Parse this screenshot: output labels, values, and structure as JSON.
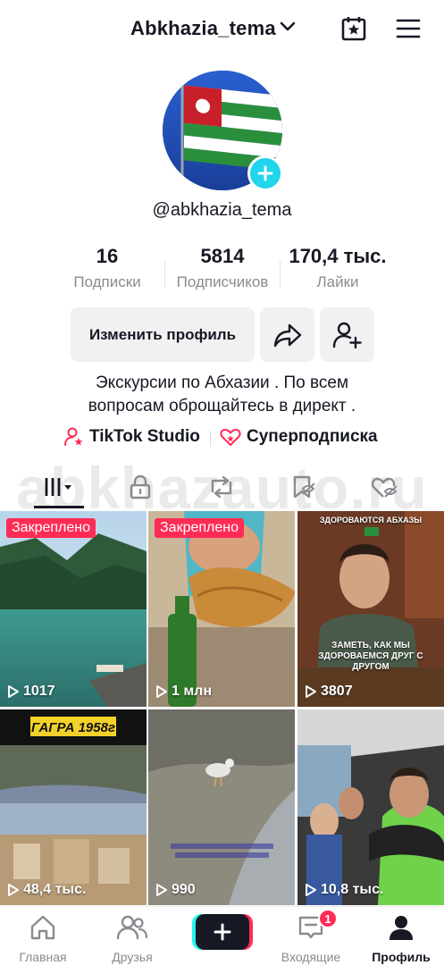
{
  "header": {
    "username": "Abkhazia_tema"
  },
  "profile": {
    "handle": "@abkhazia_tema",
    "stats": [
      {
        "value": "16",
        "label": "Подписки"
      },
      {
        "value": "5814",
        "label": "Подписчиков"
      },
      {
        "value": "170,4 тыс.",
        "label": "Лайки"
      }
    ],
    "edit_button": "Изменить профиль",
    "bio_lines": [
      "Экскурсии по Абхазии .  По всем",
      "вопросам оброщайтесь в директ ."
    ],
    "links": {
      "studio": "TikTok Studio",
      "subscription": "Суперподписка"
    }
  },
  "watermark": "abkhazauto.ru",
  "videos": [
    {
      "views": "1017",
      "pinned": "Закреплено"
    },
    {
      "views": "1 млн",
      "pinned": "Закреплено"
    },
    {
      "views": "3807",
      "caption_top": "ЗДОРОВАЮТСЯ АБХАЗЫ",
      "caption": "ЗАМЕТЬ, КАК МЫ ЗДОРОВАЕМСЯ ДРУГ С ДРУГОМ"
    },
    {
      "views": "48,4 тыс.",
      "caption_top": "ГАГРА 1958г"
    },
    {
      "views": "990"
    },
    {
      "views": "10,8 тыс."
    }
  ],
  "nav": {
    "home": "Главная",
    "friends": "Друзья",
    "inbox": "Входящие",
    "inbox_badge": "1",
    "profile": "Профиль"
  },
  "colors": {
    "accent": "#fe2c55",
    "cyan": "#20d5ec",
    "text": "#161823",
    "muted": "#8a8b91"
  }
}
